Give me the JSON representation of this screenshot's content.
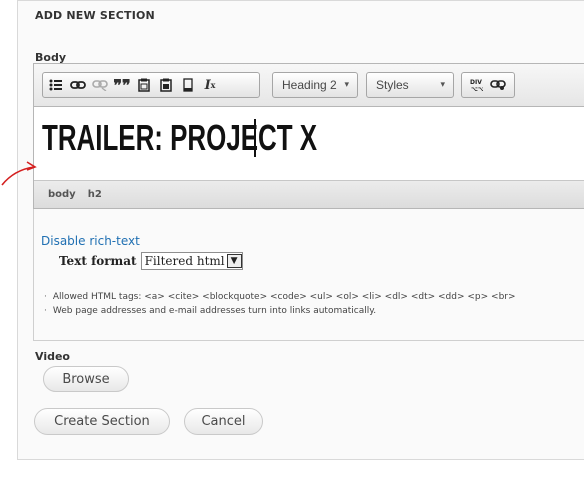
{
  "section": {
    "title": "ADD NEW SECTION"
  },
  "body_field": {
    "label": "Body",
    "editor": {
      "toolbar": {
        "group1": [
          {
            "icon": "bulleted-list-icon",
            "glyph": "⋮≡"
          },
          {
            "icon": "link-icon",
            "glyph": "⚭"
          },
          {
            "icon": "unlink-icon",
            "glyph": "⚭"
          },
          {
            "icon": "blockquote-icon",
            "glyph": "❞"
          },
          {
            "icon": "paste-text-icon",
            "glyph": "⎘"
          },
          {
            "icon": "paste-word-icon",
            "glyph": "⎘"
          },
          {
            "icon": "source-icon",
            "glyph": "▯"
          },
          {
            "icon": "remove-format-icon",
            "glyph": "Iₓ"
          }
        ],
        "format_combo": "Heading 2",
        "styles_combo": "Styles",
        "group2": [
          {
            "icon": "div-container-icon",
            "glyph": "⊞"
          },
          {
            "icon": "link-chain-icon",
            "glyph": "⚭"
          }
        ]
      },
      "content_text": "TRAILER: PROJECT X",
      "path": [
        "body",
        "h2"
      ]
    }
  },
  "text_format": {
    "disable_link": "Disable rich-text",
    "label": "Text format",
    "selected": "Filtered html",
    "tips": [
      "Allowed HTML tags: <a> <cite> <blockquote> <code> <ul> <ol> <li> <dl> <dt> <dd> <p> <br>",
      "Web page addresses and e-mail addresses turn into links automatically."
    ]
  },
  "video_field": {
    "label": "Video",
    "browse_label": "Browse"
  },
  "actions": {
    "create_label": "Create Section",
    "cancel_label": "Cancel"
  },
  "colors": {
    "link": "#1f6fb2",
    "annotation": "#d42020"
  }
}
